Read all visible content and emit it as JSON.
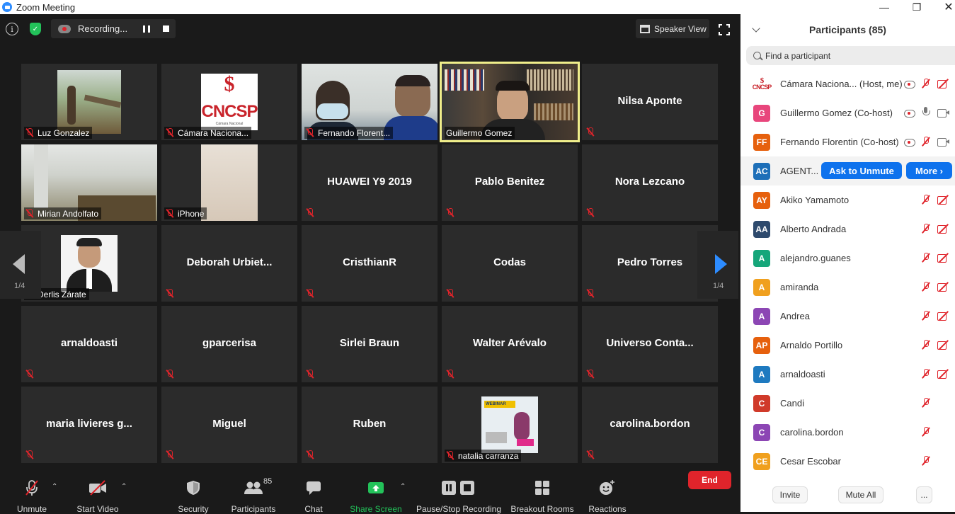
{
  "window": {
    "title": "Zoom Meeting"
  },
  "topbar": {
    "recording_label": "Recording...",
    "speaker_view_label": "Speaker View"
  },
  "grid": {
    "page_left": "1/4",
    "page_right": "1/4",
    "tiles": [
      {
        "name": "Luz Gonzalez",
        "has_video": true
      },
      {
        "name": "Cámara Naciona...",
        "has_video": true
      },
      {
        "name": "Fernando Florent...",
        "has_video": true
      },
      {
        "name": "Guillermo Gomez",
        "has_video": true,
        "active": true
      },
      {
        "name": "Nilsa Aponte",
        "has_video": false
      },
      {
        "name": "Mirian Andolfato",
        "has_video": true
      },
      {
        "name": "iPhone",
        "has_video": true
      },
      {
        "name": "HUAWEI Y9 2019",
        "has_video": false
      },
      {
        "name": "Pablo Benitez",
        "has_video": false
      },
      {
        "name": "Nora Lezcano",
        "has_video": false
      },
      {
        "name": "Derlis Zárate",
        "has_video": true
      },
      {
        "name": "Deborah  Urbiet...",
        "has_video": false
      },
      {
        "name": "CristhianR",
        "has_video": false
      },
      {
        "name": "Codas",
        "has_video": false
      },
      {
        "name": "Pedro Torres",
        "has_video": false
      },
      {
        "name": "arnaldoasti",
        "has_video": false
      },
      {
        "name": "gparcerisa",
        "has_video": false
      },
      {
        "name": "Sirlei Braun",
        "has_video": false
      },
      {
        "name": "Walter Arévalo",
        "has_video": false
      },
      {
        "name": "Universo  Conta...",
        "has_video": false
      },
      {
        "name": "maria  livieres  g...",
        "has_video": false
      },
      {
        "name": "Miguel",
        "has_video": false
      },
      {
        "name": "Ruben",
        "has_video": false
      },
      {
        "name": "natalia carranza",
        "has_video": true
      },
      {
        "name": "carolina.bordon",
        "has_video": false
      }
    ],
    "logo_text": "CNCSP",
    "logo_sub": "Cámara Nacional",
    "webinar_text": "WEBINAR"
  },
  "toolbar": {
    "unmute": "Unmute",
    "start_video": "Start Video",
    "security": "Security",
    "participants": "Participants",
    "participants_count": "85",
    "chat": "Chat",
    "share_screen": "Share Screen",
    "pause_stop_recording": "Pause/Stop Recording",
    "breakout_rooms": "Breakout Rooms",
    "reactions": "Reactions",
    "end": "End"
  },
  "panel": {
    "title": "Participants (85)",
    "search_placeholder": "Find a participant",
    "ask_to_unmute": "Ask to Unmute",
    "more": "More ›",
    "invite": "Invite",
    "mute_all": "Mute All",
    "more_options": "...",
    "participants": [
      {
        "initials": "",
        "name": "Cámara Naciona... (Host, me)",
        "color": "#ffffff",
        "logo": true,
        "rec": true,
        "mic": "off",
        "video": "off"
      },
      {
        "initials": "G",
        "name": "Guillermo Gomez (Co-host)",
        "color": "#e8467c",
        "rec": true,
        "mic": "on",
        "video": "on"
      },
      {
        "initials": "FF",
        "name": "Fernando Florentin (Co-host)",
        "color": "#e6600d",
        "rec": true,
        "mic": "off",
        "video": "on"
      },
      {
        "initials": "AC",
        "name": "AGENT...",
        "color": "#1e6fb8",
        "highlight": true
      },
      {
        "initials": "AY",
        "name": "Akiko Yamamoto",
        "color": "#e6600d",
        "mic": "off",
        "video": "off"
      },
      {
        "initials": "AA",
        "name": "Alberto Andrada",
        "color": "#2e4a6d",
        "mic": "off",
        "video": "off"
      },
      {
        "initials": "A",
        "name": "alejandro.guanes",
        "color": "#16a67a",
        "mic": "off",
        "video": "off"
      },
      {
        "initials": "A",
        "name": "amiranda",
        "color": "#f0a01e",
        "mic": "off",
        "video": "off"
      },
      {
        "initials": "A",
        "name": "Andrea",
        "color": "#8c46b4",
        "mic": "off",
        "video": "off"
      },
      {
        "initials": "AP",
        "name": "Arnaldo Portillo",
        "color": "#e6600d",
        "mic": "off",
        "video": "off"
      },
      {
        "initials": "A",
        "name": "arnaldoasti",
        "color": "#1e7ac0",
        "mic": "off",
        "video": "off"
      },
      {
        "initials": "C",
        "name": "Candi",
        "color": "#d03a2a",
        "mic": "off"
      },
      {
        "initials": "C",
        "name": "carolina.bordon",
        "color": "#8c46b4",
        "mic": "off"
      },
      {
        "initials": "CE",
        "name": "Cesar Escobar",
        "color": "#f0a01e",
        "mic": "off"
      }
    ]
  }
}
